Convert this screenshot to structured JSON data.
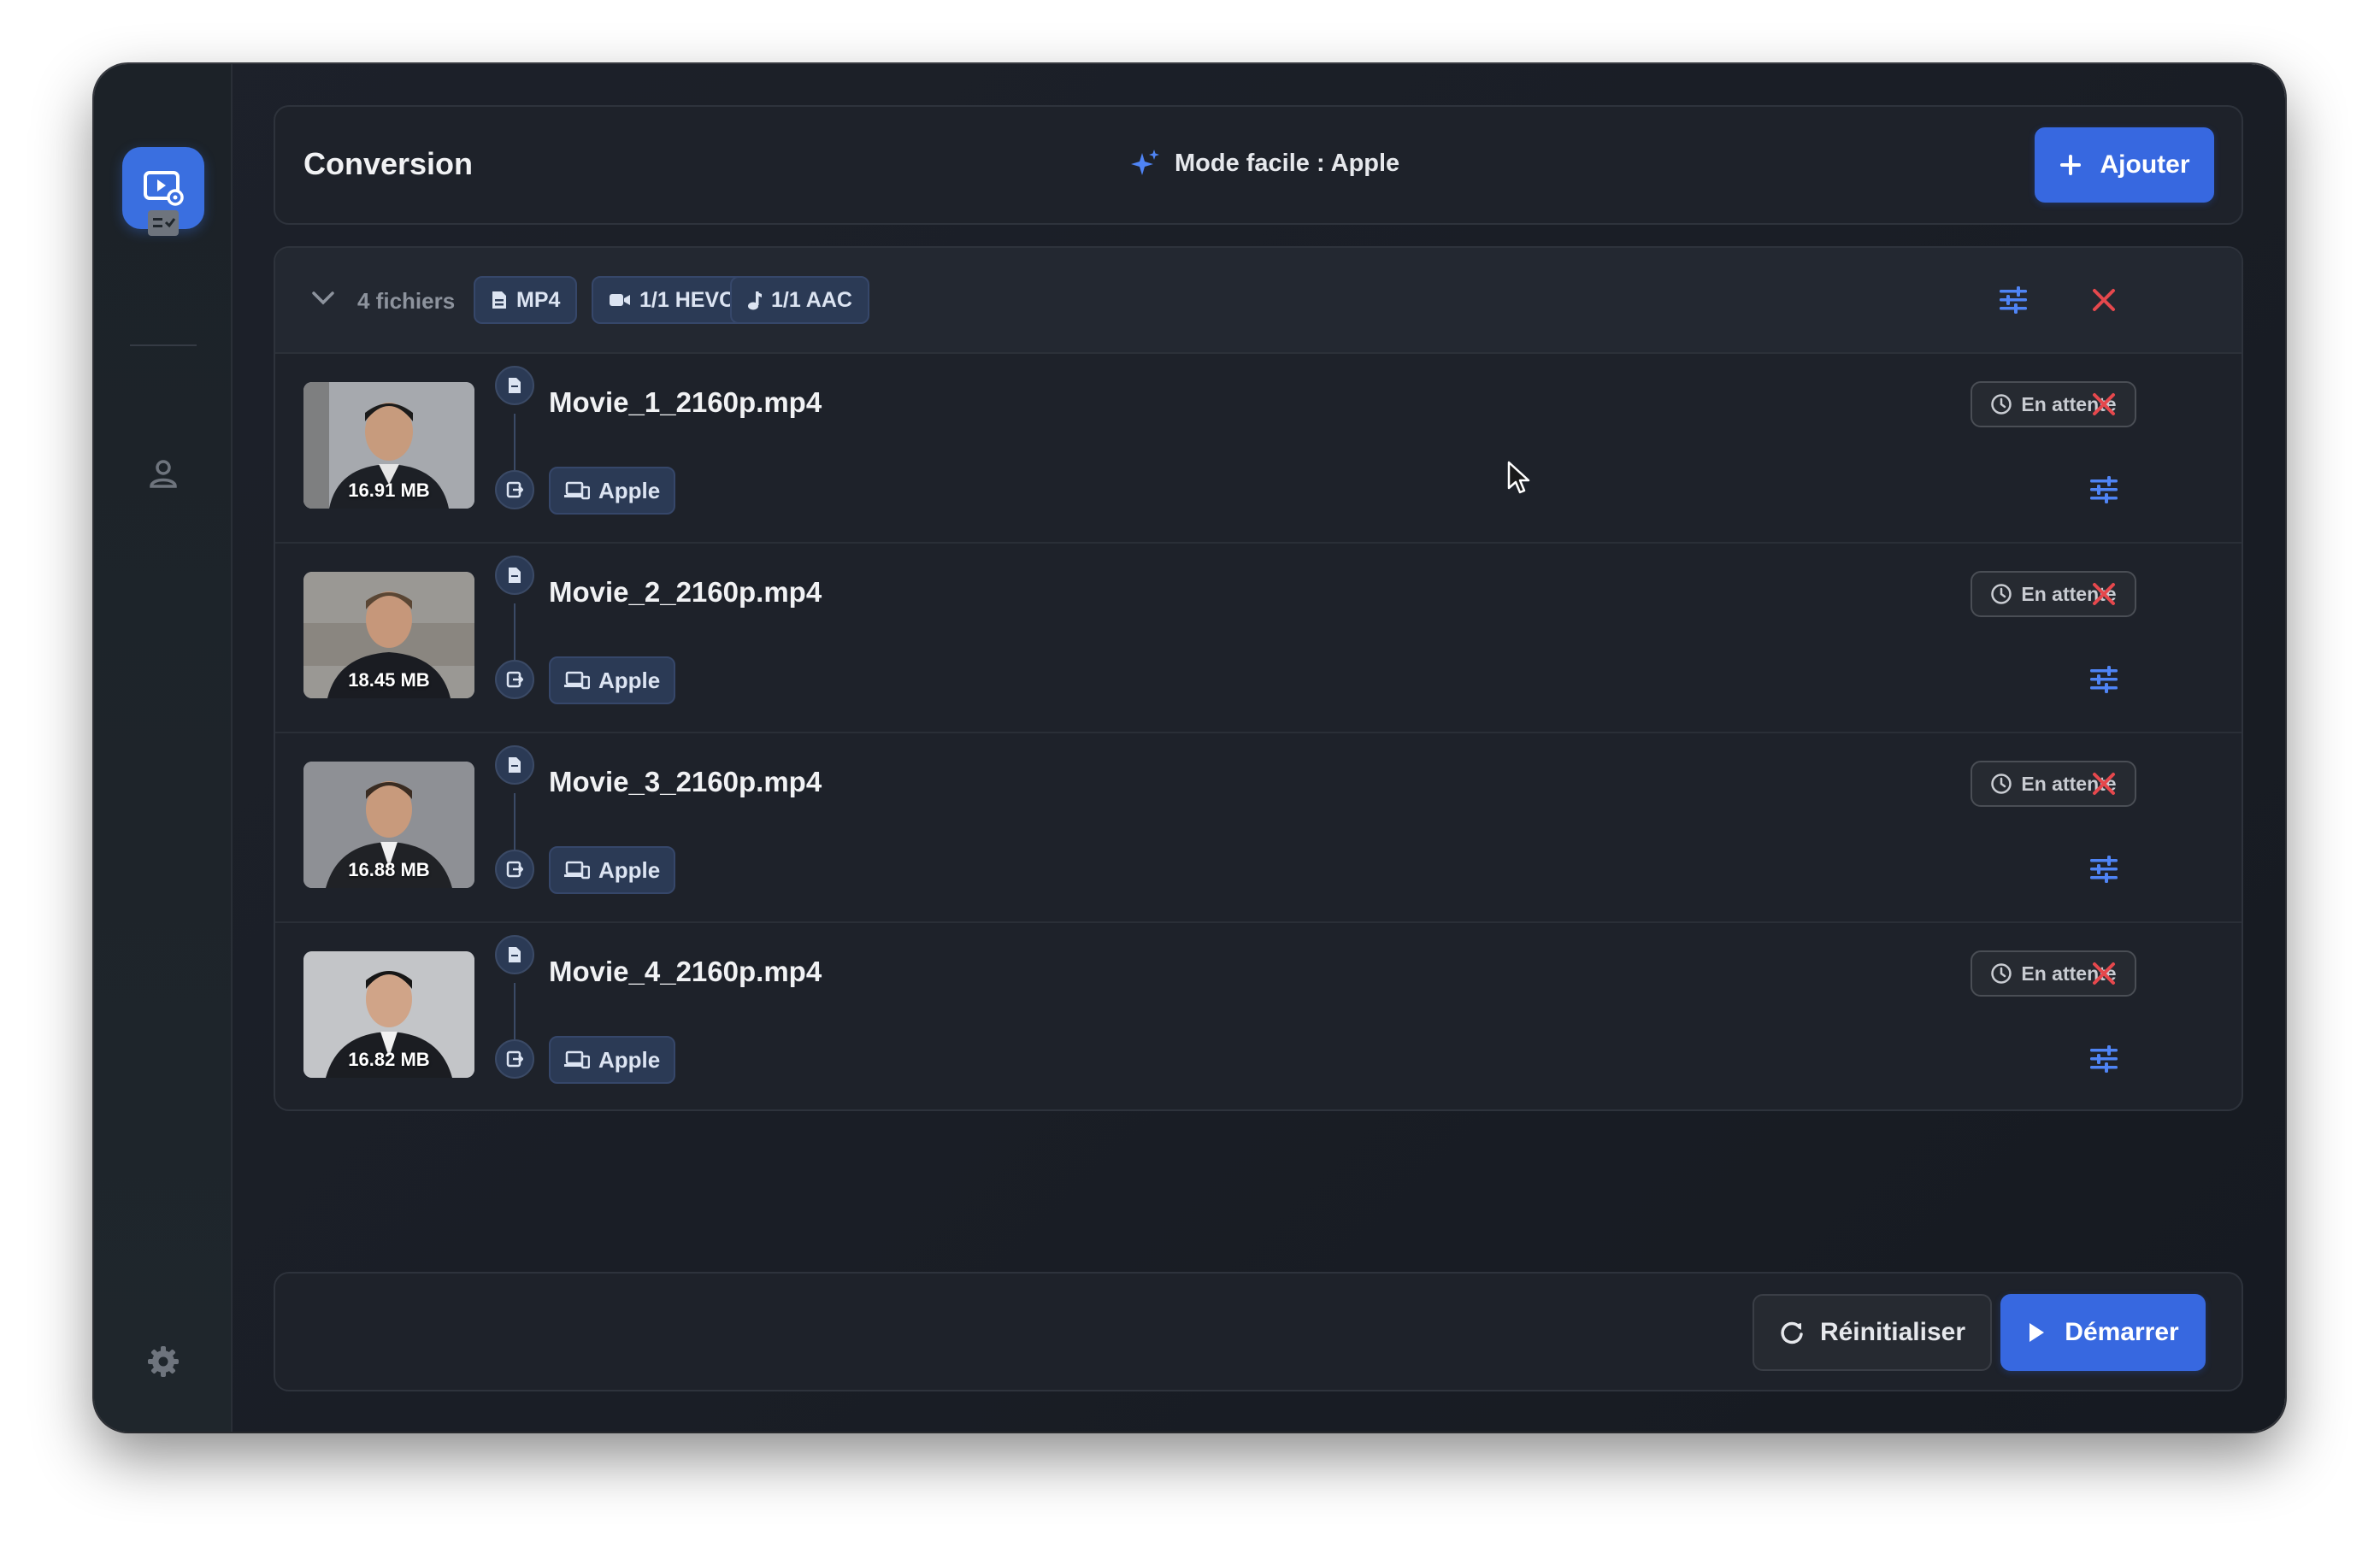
{
  "window": {
    "traffic_lights": [
      "close",
      "minimize",
      "maximize"
    ]
  },
  "sidebar": {
    "items": [
      {
        "name": "video-convert-icon",
        "active": true
      },
      {
        "name": "task-list-icon",
        "active": false
      },
      {
        "name": "account-icon",
        "active": false
      }
    ],
    "settings_icon": "gear-icon"
  },
  "header": {
    "title": "Conversion",
    "mode_label": "Mode facile : Apple",
    "add_button": "Ajouter"
  },
  "group": {
    "count_label": "4 fichiers",
    "chips": [
      {
        "icon": "file-icon",
        "label": "MP4"
      },
      {
        "icon": "video-camera-icon",
        "label": "1/1 HEVC"
      },
      {
        "icon": "music-note-icon",
        "label": "1/1 AAC"
      }
    ]
  },
  "files": [
    {
      "name": "Movie_1_2160p.mp4",
      "size": "16.91 MB",
      "preset": "Apple",
      "status": "En attente"
    },
    {
      "name": "Movie_2_2160p.mp4",
      "size": "18.45 MB",
      "preset": "Apple",
      "status": "En attente"
    },
    {
      "name": "Movie_3_2160p.mp4",
      "size": "16.88 MB",
      "preset": "Apple",
      "status": "En attente"
    },
    {
      "name": "Movie_4_2160p.mp4",
      "size": "16.82 MB",
      "preset": "Apple",
      "status": "En attente"
    }
  ],
  "footer": {
    "reset_button": "Réinitialiser",
    "start_button": "Démarrer"
  },
  "colors": {
    "accent": "#3768e0",
    "danger": "#e5484d",
    "chip_bg": "#2b3a55",
    "panel_bg": "#1e222a"
  }
}
